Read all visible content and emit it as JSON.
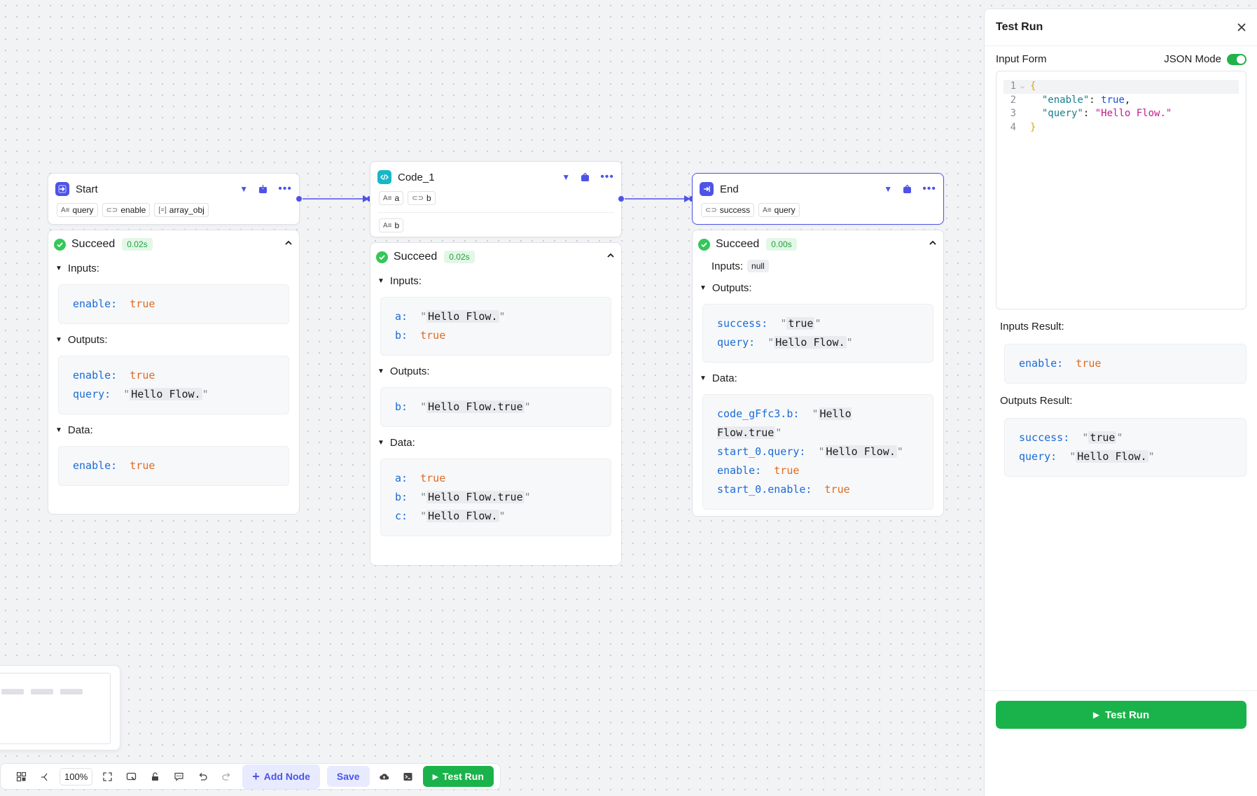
{
  "canvas": {
    "zoom": "100%"
  },
  "nodes": {
    "start": {
      "title": "Start",
      "tags": [
        {
          "icon": "string-icon",
          "label": "query"
        },
        {
          "icon": "boolean-icon",
          "label": "enable"
        },
        {
          "icon": "array-icon",
          "label": "array_obj"
        }
      ],
      "result": {
        "status": "Succeed",
        "duration": "0.02s",
        "inputs_label": "Inputs:",
        "inputs": [
          {
            "key": "enable:",
            "value": "true",
            "type": "bool"
          }
        ],
        "outputs_label": "Outputs:",
        "outputs": [
          {
            "key": "enable:",
            "value": "true",
            "type": "bool"
          },
          {
            "key": "query:",
            "value": "Hello Flow.",
            "type": "str"
          }
        ],
        "data_label": "Data:",
        "data": [
          {
            "key": "enable:",
            "value": "true",
            "type": "bool"
          }
        ]
      }
    },
    "code": {
      "title": "Code_1",
      "input_tags": [
        {
          "icon": "string-icon",
          "label": "a"
        },
        {
          "icon": "boolean-icon",
          "label": "b"
        }
      ],
      "output_tags": [
        {
          "icon": "string-icon",
          "label": "b"
        }
      ],
      "result": {
        "status": "Succeed",
        "duration": "0.02s",
        "inputs_label": "Inputs:",
        "inputs": [
          {
            "key": "a:",
            "value": "Hello Flow.",
            "type": "str"
          },
          {
            "key": "b:",
            "value": "true",
            "type": "bool"
          }
        ],
        "outputs_label": "Outputs:",
        "outputs": [
          {
            "key": "b:",
            "value": "Hello Flow.true",
            "type": "str"
          }
        ],
        "data_label": "Data:",
        "data": [
          {
            "key": "a:",
            "value": "true",
            "type": "bool"
          },
          {
            "key": "b:",
            "value": "Hello Flow.true",
            "type": "str"
          },
          {
            "key": "c:",
            "value": "Hello Flow.",
            "type": "str"
          }
        ]
      }
    },
    "end": {
      "title": "End",
      "tags": [
        {
          "icon": "boolean-icon",
          "label": "success"
        },
        {
          "icon": "string-icon",
          "label": "query"
        }
      ],
      "result": {
        "status": "Succeed",
        "duration": "0.00s",
        "inputs_label": "Inputs:",
        "inputs_value": "null",
        "outputs_label": "Outputs:",
        "outputs": [
          {
            "key": "success:",
            "value": "true",
            "type": "str"
          },
          {
            "key": "query:",
            "value": "Hello Flow.",
            "type": "str"
          }
        ],
        "data_label": "Data:",
        "data": [
          {
            "key": "code_gFfc3.b:",
            "value": "Hello Flow.true",
            "type": "str"
          },
          {
            "key": "start_0.query:",
            "value": "Hello Flow.",
            "type": "str"
          },
          {
            "key": "enable:",
            "value": "true",
            "type": "bool"
          },
          {
            "key": "start_0.enable:",
            "value": "true",
            "type": "bool"
          }
        ]
      }
    }
  },
  "panel": {
    "title": "Test Run",
    "input_form_label": "Input Form",
    "json_mode_label": "JSON Mode",
    "json_mode_on": true,
    "editor_lines": [
      {
        "n": "1",
        "text": "{"
      },
      {
        "n": "2",
        "key": "\"enable\"",
        "sep": ": ",
        "value": "true",
        "tail": ","
      },
      {
        "n": "3",
        "key": "\"query\"",
        "sep": ": ",
        "value": "\"Hello Flow.\"",
        "tail": ""
      },
      {
        "n": "4",
        "text": "}"
      }
    ],
    "inputs_result_label": "Inputs Result:",
    "inputs_result": [
      {
        "key": "enable:",
        "value": "true",
        "type": "bool"
      }
    ],
    "outputs_result_label": "Outputs Result:",
    "outputs_result": [
      {
        "key": "success:",
        "value": "true",
        "type": "str"
      },
      {
        "key": "query:",
        "value": "Hello Flow.",
        "type": "str"
      }
    ],
    "run_button": "Test Run"
  },
  "toolbar": {
    "add_node": "Add Node",
    "save": "Save",
    "test_run": "Test Run"
  },
  "colors": {
    "accent": "#4d53e8",
    "success": "#34c759",
    "run_green": "#1ab34b",
    "key_blue": "#1a6bd6",
    "bool_orange": "#e06b1f"
  }
}
